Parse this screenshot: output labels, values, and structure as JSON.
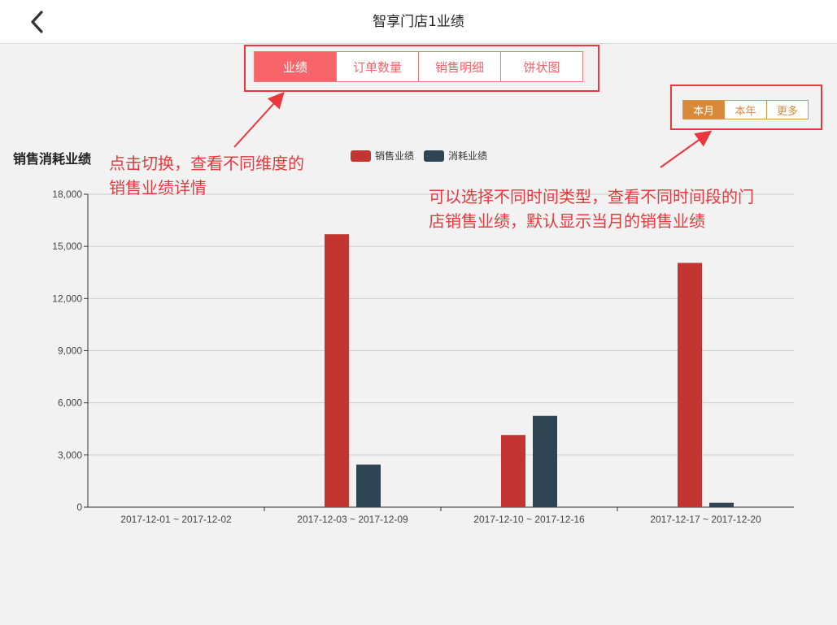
{
  "header": {
    "title": "智享门店1业绩"
  },
  "tabs": [
    {
      "label": "业绩",
      "active": true
    },
    {
      "label": "订单数量",
      "active": false
    },
    {
      "label": "销售明细",
      "active": false
    },
    {
      "label": "饼状图",
      "active": false
    }
  ],
  "periods": [
    {
      "label": "本月",
      "active": true
    },
    {
      "label": "本年",
      "active": false
    },
    {
      "label": "更多",
      "active": false
    }
  ],
  "annotations": {
    "tabs_note": [
      "点击切换，查看不同维度的",
      "销售业绩详情"
    ],
    "period_note": [
      "可以选择不同时间类型，查看不同时间段的门",
      "店销售业绩，默认显示当月的销售业绩"
    ]
  },
  "colors": {
    "tab_accent": "#f7646a",
    "period_accent": "#d9893a",
    "annotation_red": "#e8383d"
  },
  "chart_data": {
    "type": "bar",
    "title": "销售消耗业绩",
    "categories": [
      "2017-12-01 ~ 2017-12-02",
      "2017-12-03 ~ 2017-12-09",
      "2017-12-10 ~ 2017-12-16",
      "2017-12-17 ~ 2017-12-20"
    ],
    "series": [
      {
        "name": "销售业绩",
        "color": "#c23531",
        "values": [
          0,
          15700,
          4150,
          14050
        ]
      },
      {
        "name": "消耗业绩",
        "color": "#2f4554",
        "values": [
          0,
          2450,
          5250,
          250
        ]
      }
    ],
    "ylim": [
      0,
      18000
    ],
    "yticks": [
      0,
      3000,
      6000,
      9000,
      12000,
      15000,
      18000
    ],
    "ytick_labels": [
      "0",
      "3,000",
      "6,000",
      "9,000",
      "12,000",
      "15,000",
      "18,000"
    ],
    "grid": true,
    "legend": "top-center"
  }
}
